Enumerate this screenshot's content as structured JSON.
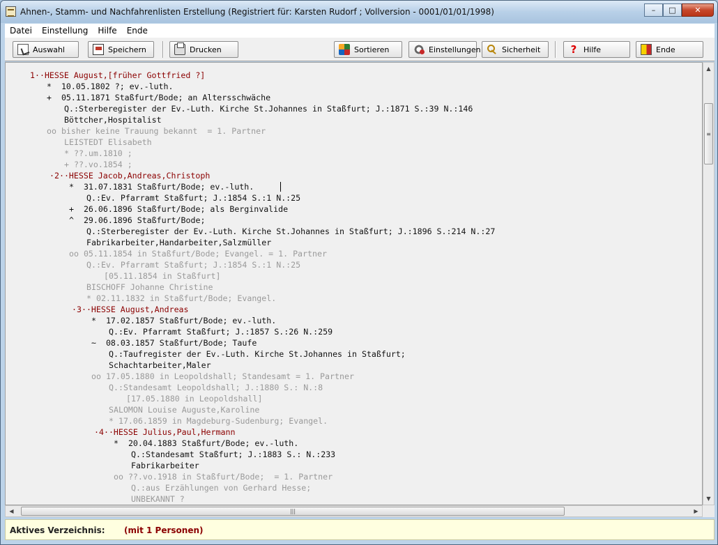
{
  "window": {
    "title": "Ahnen-, Stamm- und Nachfahrenlisten Erstellung  (Registriert für: Karsten Rudorf ; Vollversion - 0001/01/01/1998)",
    "controls": {
      "minimize": "–",
      "maximize": "□",
      "close": "✕"
    }
  },
  "menu": [
    "Datei",
    "Einstellung",
    "Hilfe",
    "Ende"
  ],
  "toolbar": {
    "auswahl": "Auswahl",
    "speichern": "Speichern",
    "drucken": "Drucken",
    "sortieren": "Sortieren",
    "einstellungen": "Einstellungen",
    "sicherheit": "Sicherheit",
    "hilfe": "Hilfe",
    "ende": "Ende",
    "hilfe_glyph": "?"
  },
  "lines": [
    {
      "text": "1··HESSE August,[früher Gottfried ?]",
      "style": "red"
    },
    {
      "text": "*  10.05.1802 ?; ev.-luth.",
      "style": "black"
    },
    {
      "text": "+  05.11.1871 Staßfurt/Bode; an Altersschwäche",
      "style": "black"
    },
    {
      "text": "Q.:Sterberegister der Ev.-Luth. Kirche St.Johannes in Staßfurt; J.:1871 S.:39 N.:146",
      "style": "black"
    },
    {
      "text": "Böttcher,Hospitalist",
      "style": "black"
    },
    {
      "text": "oo bisher keine Trauung bekannt  = 1. Partner",
      "style": "gray"
    },
    {
      "text": "LEISTEDT Elisabeth",
      "style": "gray"
    },
    {
      "text": "* ??.um.1810 ;",
      "style": "gray"
    },
    {
      "text": "+ ??.vo.1854 ;",
      "style": "gray"
    },
    {
      "text": "·2··HESSE Jacob,Andreas,Christoph",
      "style": "red"
    },
    {
      "text": "*  31.07.1831 Staßfurt/Bode; ev.-luth.",
      "style": "black"
    },
    {
      "text": "Q.:Ev. Pfarramt Staßfurt; J.:1854 S.:1 N.:25",
      "style": "black"
    },
    {
      "text": "+  26.06.1896 Staßfurt/Bode; als Berginvalide",
      "style": "black"
    },
    {
      "text": "^  29.06.1896 Staßfurt/Bode;",
      "style": "black"
    },
    {
      "text": "Q.:Sterberegister der Ev.-Luth. Kirche St.Johannes in Staßfurt; J.:1896 S.:214 N.:27",
      "style": "black"
    },
    {
      "text": "Fabrikarbeiter,Handarbeiter,Salzmüller",
      "style": "black"
    },
    {
      "text": "oo 05.11.1854 in Staßfurt/Bode; Evangel. = 1. Partner",
      "style": "gray"
    },
    {
      "text": "Q.:Ev. Pfarramt Staßfurt; J.:1854 S.:1 N.:25",
      "style": "gray"
    },
    {
      "text": "[05.11.1854 in Staßfurt]",
      "style": "gray"
    },
    {
      "text": "BISCHOFF Johanne Christine",
      "style": "gray"
    },
    {
      "text": "* 02.11.1832 in Staßfurt/Bode; Evangel.",
      "style": "gray"
    },
    {
      "text": "·3··HESSE August,Andreas",
      "style": "red"
    },
    {
      "text": "*  17.02.1857 Staßfurt/Bode; ev.-luth.",
      "style": "black"
    },
    {
      "text": "Q.:Ev. Pfarramt Staßfurt; J.:1857 S.:26 N.:259",
      "style": "black"
    },
    {
      "text": "~  08.03.1857 Staßfurt/Bode; Taufe",
      "style": "black"
    },
    {
      "text": "Q.:Taufregister der Ev.-Luth. Kirche St.Johannes in Staßfurt;",
      "style": "black"
    },
    {
      "text": "Schachtarbeiter,Maler",
      "style": "black"
    },
    {
      "text": "oo 17.05.1880 in Leopoldshall; Standesamt = 1. Partner",
      "style": "gray"
    },
    {
      "text": "Q.:Standesamt Leopoldshall; J.:1880 S.: N.:8",
      "style": "gray"
    },
    {
      "text": "[17.05.1880 in Leopoldshall]",
      "style": "gray"
    },
    {
      "text": "SALOMON Louise Auguste,Karoline",
      "style": "gray"
    },
    {
      "text": "* 17.06.1859 in Magdeburg-Sudenburg; Evangel.",
      "style": "gray"
    },
    {
      "text": "·4··HESSE Julius,Paul,Hermann",
      "style": "red"
    },
    {
      "text": "*  20.04.1883 Staßfurt/Bode; ev.-luth.",
      "style": "black"
    },
    {
      "text": "Q.:Standesamt Staßfurt; J.:1883 S.: N.:233",
      "style": "black"
    },
    {
      "text": "Fabrikarbeiter",
      "style": "black"
    },
    {
      "text": "oo ??.vo.1918 in Staßfurt/Bode;  = 1. Partner",
      "style": "gray"
    },
    {
      "text": "Q.:aus Erzählungen von Gerhard Hesse;",
      "style": "gray"
    },
    {
      "text": "UNBEKANNT ?",
      "style": "gray"
    }
  ],
  "scrollbars": {
    "up": "▲",
    "down": "▼",
    "left": "◀",
    "right": "▶",
    "grip_v": "≡",
    "grip_h": "|||"
  },
  "status": {
    "label": "Aktives Verzeichnis:",
    "value": "(mit 1 Personen)"
  }
}
